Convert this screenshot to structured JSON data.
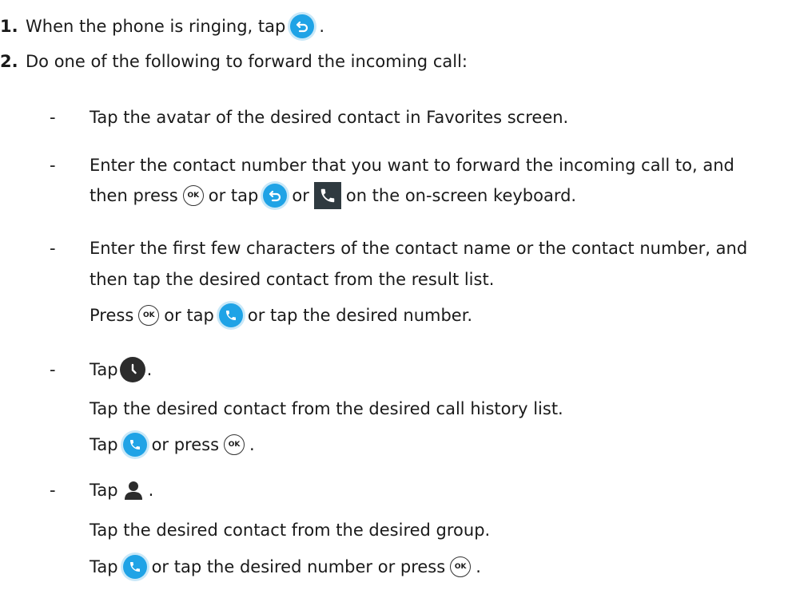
{
  "steps": [
    {
      "num": "1.",
      "text_a": "When the phone is ringing, tap",
      "text_b": "."
    },
    {
      "num": "2.",
      "text": "Do one of the following to forward the incoming call:"
    }
  ],
  "options": {
    "favorites": {
      "bullet": "-",
      "text": "Tap the avatar of the desired contact in Favorites screen."
    },
    "enter_number": {
      "bullet": "-",
      "line1": "Enter the contact number that you want to forward the incoming call to, and",
      "line2_a": "then press",
      "line2_b": "or tap",
      "line2_c": "or",
      "line2_d": "on the on-screen keyboard."
    },
    "enter_chars": {
      "bullet": "-",
      "line1": "Enter the first few characters of the contact name or the contact number, and",
      "line2": "then tap the desired contact from the result list.",
      "line3_a": "Press",
      "line3_b": "or tap",
      "line3_c": "or tap the desired number."
    },
    "history": {
      "bullet": "-",
      "line1_a": "Tap",
      "line1_b": ".",
      "line2": "Tap the desired contact from the desired call history list.",
      "line3_a": "Tap",
      "line3_b": "or press",
      "line3_c": "."
    },
    "directory": {
      "bullet": "-",
      "line1_a": "Tap",
      "line1_b": ".",
      "line2": "Tap the desired contact from the desired group.",
      "line3_a": "Tap",
      "line3_b": "or tap the desired number or press",
      "line3_c": "."
    }
  },
  "icons": {
    "ok_label": "OK",
    "forward": "forward-icon",
    "call": "call-icon",
    "ok_key": "ok-key-icon",
    "keyboard_send": "keyboard-send-icon",
    "history": "history-icon",
    "directory": "directory-icon",
    "accent_color": "#1fa3e6"
  }
}
